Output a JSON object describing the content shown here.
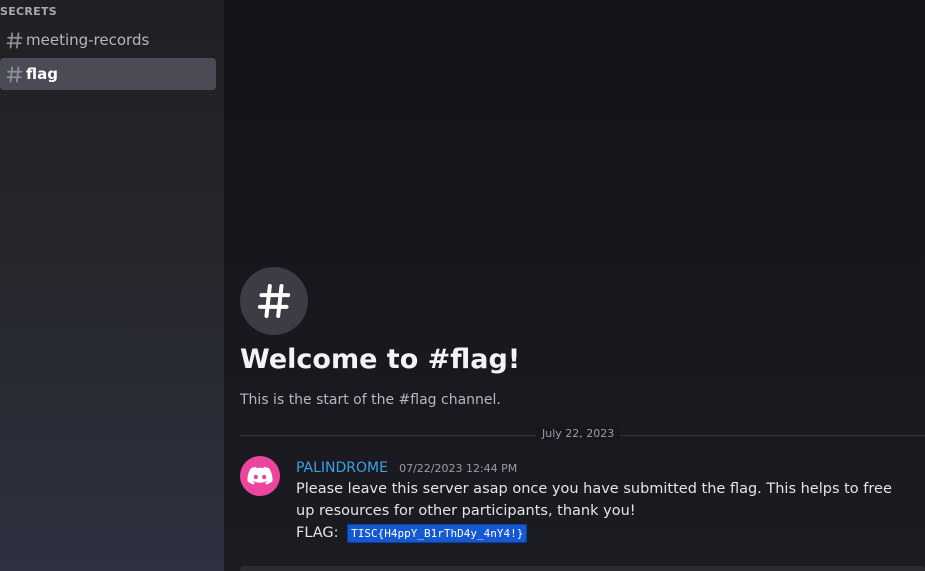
{
  "sidebar": {
    "category": "SECRETS",
    "channels": [
      {
        "name": "meeting-records",
        "icon": "hash-icon"
      },
      {
        "name": "flag",
        "icon": "hash-icon",
        "selected": true
      }
    ]
  },
  "welcome": {
    "icon": "hash-icon",
    "title": "Welcome to #flag!",
    "subtitle": "This is the start of the #flag channel."
  },
  "date_divider": "July 22, 2023",
  "message": {
    "avatar": "discord-logo-icon",
    "username": "PALINDROME",
    "timestamp": "07/22/2023 12:44 PM",
    "text": "Please leave this server asap once you have submitted the flag. This helps to free up resources for other participants, thank you!",
    "flag_label": "FLAG:",
    "flag_value": "TISC{H4ppY_B1rThD4y_4nY4!}"
  },
  "colors": {
    "username": "#3aa0e8",
    "avatar_bg": "#eb459e",
    "selection": "#1458d4"
  }
}
